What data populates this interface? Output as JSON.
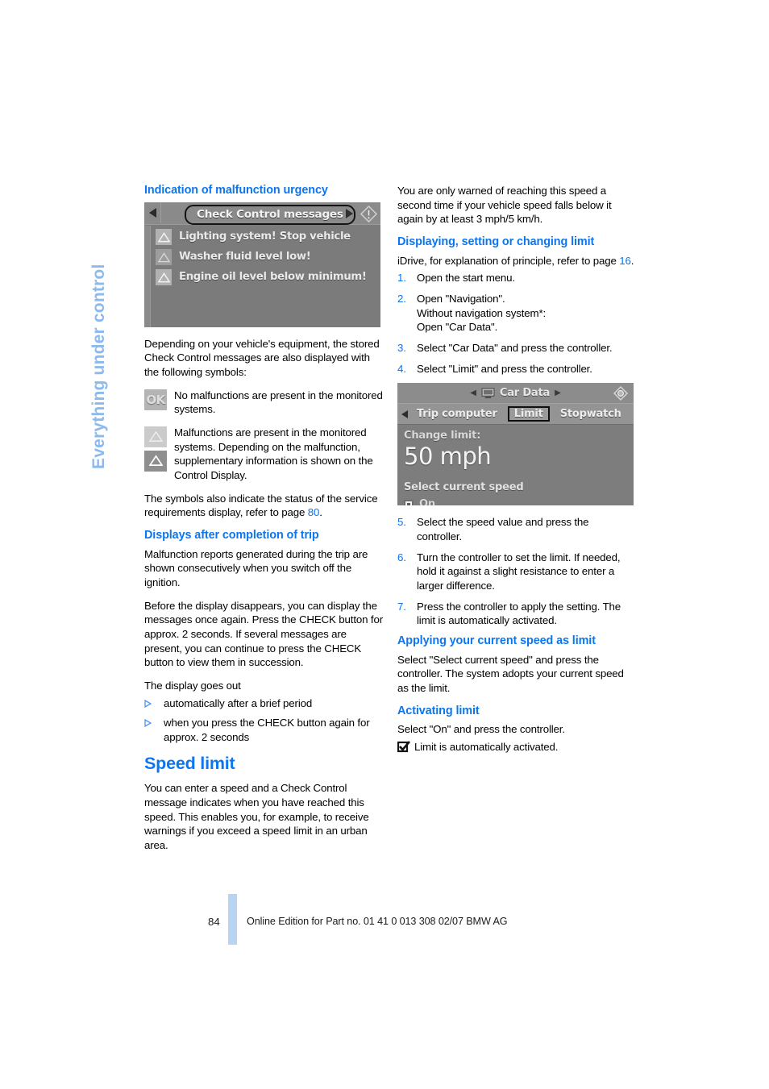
{
  "chapter": {
    "side_title": "Everything under control"
  },
  "left_column": {
    "section1_heading": "Indication of malfunction urgency",
    "figure_check_control": {
      "title": "Check Control messages",
      "messages": [
        "Lighting system! Stop vehicle",
        "Washer fluid level low!",
        "Engine oil level below minimum!"
      ],
      "left_arrow_icon": "triangle-left-icon",
      "right_arrow_icon": "triangle-right-icon",
      "info_icon": "warning-info-icon",
      "credit": ""
    },
    "intro_paragraph": "Depending on your vehicle's equipment, the stored Check Control messages are also displayed with the following symbols:",
    "symbols": [
      {
        "icon": "ok-symbol",
        "icon_label": "OK",
        "text": "No malfunctions are present in the monitored systems."
      },
      {
        "icon": "warning-triangle-symbol",
        "icon_label": "",
        "text": "Malfunctions are present in the monitored systems. Depending on the malfunction, supplementary information is shown on the Control Display."
      }
    ],
    "service_note_part1": "The symbols also indicate the status of the service requirements display, refer to page ",
    "service_note_link": "80",
    "service_note_part2": ".",
    "section2_heading": "Displays after completion of trip",
    "section2_p1": "Malfunction reports generated during the trip are shown consecutively when you switch off the ignition.",
    "section2_p2": "Before the display disappears, you can display the messages once again. Press the CHECK button for approx. 2 seconds. If several messages are present, you can continue to press the CHECK button to view them in succession.",
    "section2_p3": "The display goes out",
    "section2_bullets": [
      "automatically after a brief period",
      "when you press the CHECK button again for approx. 2 seconds"
    ],
    "chapter_heading": "Speed limit",
    "chapter_paragraph": "You can enter a speed and a Check Control message indicates when you have reached this speed. This enables you, for example, to receive warnings if you exceed a speed limit in an urban area."
  },
  "right_column": {
    "intro_paragraph": "You are only warned of reaching this speed a second time if your vehicle speed falls below it again by at least 3 mph/5 km/h.",
    "section1_heading": "Displaying, setting or changing limit",
    "idrive_note_part1": "iDrive, for explanation of principle, refer to page ",
    "idrive_note_link": "16",
    "idrive_note_part2": ".",
    "steps_a": [
      {
        "num": "1.",
        "text": "Open the start menu."
      },
      {
        "num": "2.",
        "text": "Open \"Navigation\".\nWithout navigation system*:\nOpen \"Car Data\"."
      },
      {
        "num": "3.",
        "text": "Select \"Car Data\" and press the controller."
      },
      {
        "num": "4.",
        "text": "Select \"Limit\" and press the controller."
      }
    ],
    "figure_car_data": {
      "header_title": "Car Data",
      "header_monitor_icon": "monitor-icon",
      "header_gear_icon": "settings-icon",
      "tabs": [
        "Trip computer",
        "Limit",
        "Stopwatch"
      ],
      "selected_tab": "Limit",
      "change_limit_label": "Change limit:",
      "limit_value": "50 mph",
      "select_current_speed": "Select current speed",
      "on_label": "On",
      "credit": ""
    },
    "steps_b": [
      {
        "num": "5.",
        "text": "Select the speed value and press the controller."
      },
      {
        "num": "6.",
        "text": "Turn the controller to set the limit. If needed, hold it against a slight resistance to enter a larger difference."
      },
      {
        "num": "7.",
        "text": "Press the controller to apply the setting. The limit is automatically activated."
      }
    ],
    "section2_heading": "Applying your current speed as limit",
    "section2_paragraph": "Select \"Select current speed\" and press the controller. The system adopts your current speed as the limit.",
    "section3_heading": "Activating limit",
    "section3_paragraph": "Select \"On\" and press the controller.",
    "section3_activated": "Limit is automatically activated.",
    "section3_check_icon": "checkbox-checked-icon"
  },
  "footer": {
    "page_number": "84",
    "imprint": "Online Edition for Part no. 01 41 0 013 308 02/07 BMW AG"
  },
  "colors": {
    "heading_blue": "#0b76f0",
    "side_title_blue": "#8cb9ee",
    "footer_bar_blue": "#b9d4f2"
  }
}
